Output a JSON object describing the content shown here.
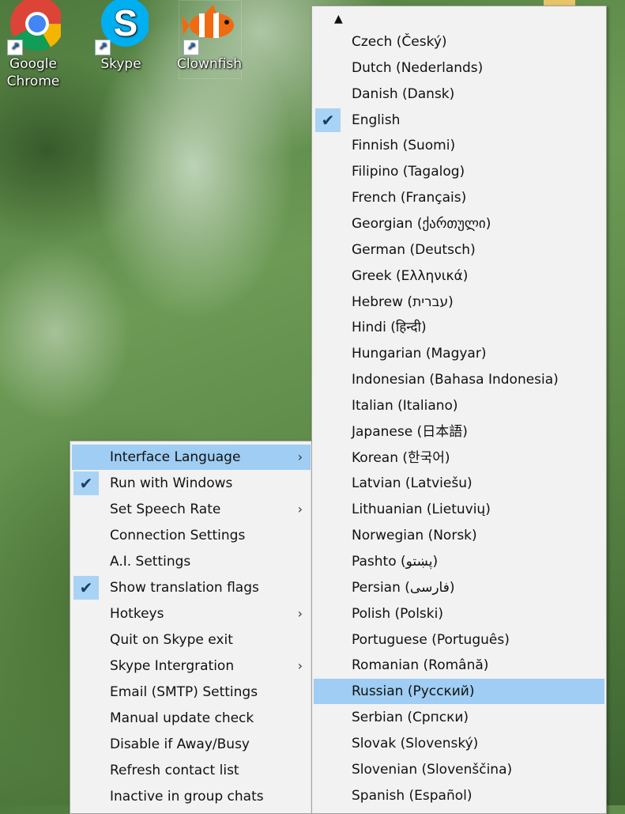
{
  "desktop": {
    "icons": [
      {
        "label_line1": "Google",
        "label_line2": "Chrome",
        "icon": "chrome-icon"
      },
      {
        "label_line1": "Skype",
        "label_line2": "",
        "icon": "skype-icon"
      },
      {
        "label_line1": "Clownfish",
        "label_line2": "",
        "icon": "clownfish-icon"
      }
    ]
  },
  "main_menu": {
    "items": [
      {
        "label": "Interface Language",
        "checked": false,
        "submenu": true,
        "highlighted": true
      },
      {
        "label": "Run with Windows",
        "checked": true,
        "submenu": false
      },
      {
        "label": "Set Speech Rate",
        "checked": false,
        "submenu": true
      },
      {
        "label": "Connection Settings",
        "checked": false,
        "submenu": false
      },
      {
        "label": "A.I. Settings",
        "checked": false,
        "submenu": false
      },
      {
        "label": "Show translation flags",
        "checked": true,
        "submenu": false
      },
      {
        "label": "Hotkeys",
        "checked": false,
        "submenu": true
      },
      {
        "label": "Quit on Skype exit",
        "checked": false,
        "submenu": false
      },
      {
        "label": "Skype Intergration",
        "checked": false,
        "submenu": true
      },
      {
        "label": "Email (SMTP) Settings",
        "checked": false,
        "submenu": false
      },
      {
        "label": "Manual update check",
        "checked": false,
        "submenu": false
      },
      {
        "label": "Disable if Away/Busy",
        "checked": false,
        "submenu": false
      },
      {
        "label": "Refresh contact list",
        "checked": false,
        "submenu": false
      },
      {
        "label": "Inactive in group chats",
        "checked": false,
        "submenu": false
      }
    ],
    "check_glyph": "✔",
    "arrow_glyph": "›"
  },
  "language_menu": {
    "scroll_up_glyph": "▲",
    "items": [
      {
        "label": "Czech (Český)"
      },
      {
        "label": "Dutch (Nederlands)"
      },
      {
        "label": "Danish (Dansk)"
      },
      {
        "label": "English",
        "checked": true
      },
      {
        "label": "Finnish (Suomi)"
      },
      {
        "label": "Filipino (Tagalog)"
      },
      {
        "label": "French (Français)"
      },
      {
        "label": "Georgian (ქართული)"
      },
      {
        "label": "German (Deutsch)"
      },
      {
        "label": "Greek (Ελληνικά)"
      },
      {
        "label": "Hebrew (עברית)"
      },
      {
        "label": "Hindi (हिन्दी)"
      },
      {
        "label": "Hungarian (Magyar)"
      },
      {
        "label": "Indonesian (Bahasa Indonesia)"
      },
      {
        "label": "Italian (Italiano)"
      },
      {
        "label": "Japanese (日本語)"
      },
      {
        "label": "Korean (한국어)"
      },
      {
        "label": "Latvian (Latviešu)"
      },
      {
        "label": "Lithuanian (Lietuvių)"
      },
      {
        "label": "Norwegian (Norsk)"
      },
      {
        "label": "Pashto (پښتو)"
      },
      {
        "label": "Persian (فارسی)"
      },
      {
        "label": "Polish (Polski)"
      },
      {
        "label": "Portuguese (Português)"
      },
      {
        "label": "Romanian (Română)"
      },
      {
        "label": "Russian (Русский)",
        "highlighted": true
      },
      {
        "label": "Serbian (Српски)"
      },
      {
        "label": "Slovak (Slovenský)"
      },
      {
        "label": "Slovenian (Slovenščina)"
      },
      {
        "label": "Spanish (Español)"
      }
    ]
  },
  "colors": {
    "highlight": "#9fcdf3",
    "check_bg": "#a9d3f5",
    "menu_bg": "#f2f2f2"
  }
}
